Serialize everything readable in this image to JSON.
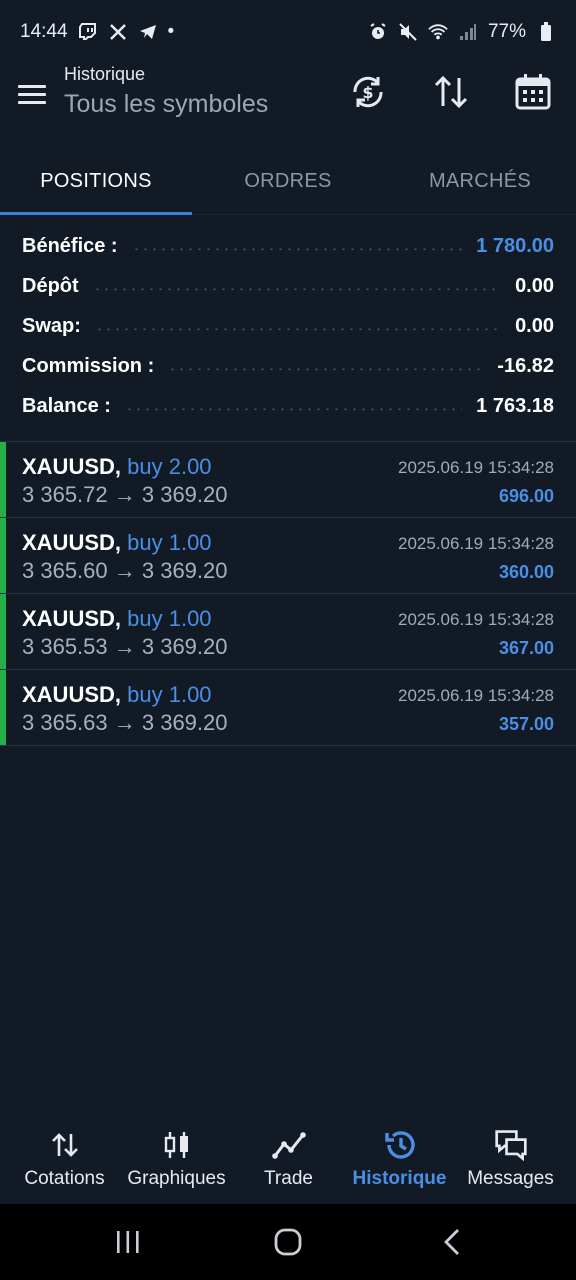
{
  "status_bar": {
    "time": "14:44",
    "battery": "77%",
    "dot": "•"
  },
  "header": {
    "title": "Historique",
    "subtitle": "Tous les symboles"
  },
  "tabs": [
    {
      "label": "POSITIONS",
      "active": true
    },
    {
      "label": "ORDRES",
      "active": false
    },
    {
      "label": "MARCHÉS",
      "active": false
    }
  ],
  "summary": [
    {
      "label": "Bénéfice :",
      "value": "1 780.00",
      "highlight": true
    },
    {
      "label": "Dépôt",
      "value": "0.00",
      "highlight": false
    },
    {
      "label": "Swap:",
      "value": "0.00",
      "highlight": false
    },
    {
      "label": "Commission :",
      "value": "-16.82",
      "highlight": false
    },
    {
      "label": "Balance :",
      "value": "1 763.18",
      "highlight": false
    }
  ],
  "trades": [
    {
      "symbol": "XAUUSD,",
      "side": "buy 2.00",
      "prices": "3 365.72 → 3 369.20",
      "time": "2025.06.19 15:34:28",
      "profit": "696.00"
    },
    {
      "symbol": "XAUUSD,",
      "side": "buy 1.00",
      "prices": "3 365.60 → 3 369.20",
      "time": "2025.06.19 15:34:28",
      "profit": "360.00"
    },
    {
      "symbol": "XAUUSD,",
      "side": "buy 1.00",
      "prices": "3 365.53 → 3 369.20",
      "time": "2025.06.19 15:34:28",
      "profit": "367.00"
    },
    {
      "symbol": "XAUUSD,",
      "side": "buy 1.00",
      "prices": "3 365.63 → 3 369.20",
      "time": "2025.06.19 15:34:28",
      "profit": "357.00"
    }
  ],
  "bottom_nav": [
    {
      "label": "Cotations",
      "icon": "quotes-icon",
      "active": false
    },
    {
      "label": "Graphiques",
      "icon": "chart-icon",
      "active": false
    },
    {
      "label": "Trade",
      "icon": "trade-icon",
      "active": false
    },
    {
      "label": "Historique",
      "icon": "history-icon",
      "active": true
    },
    {
      "label": "Messages",
      "icon": "messages-icon",
      "active": false
    }
  ],
  "colors": {
    "background": "#121a26",
    "accent": "#4a8fe6",
    "buy_bar": "#26b04a"
  }
}
